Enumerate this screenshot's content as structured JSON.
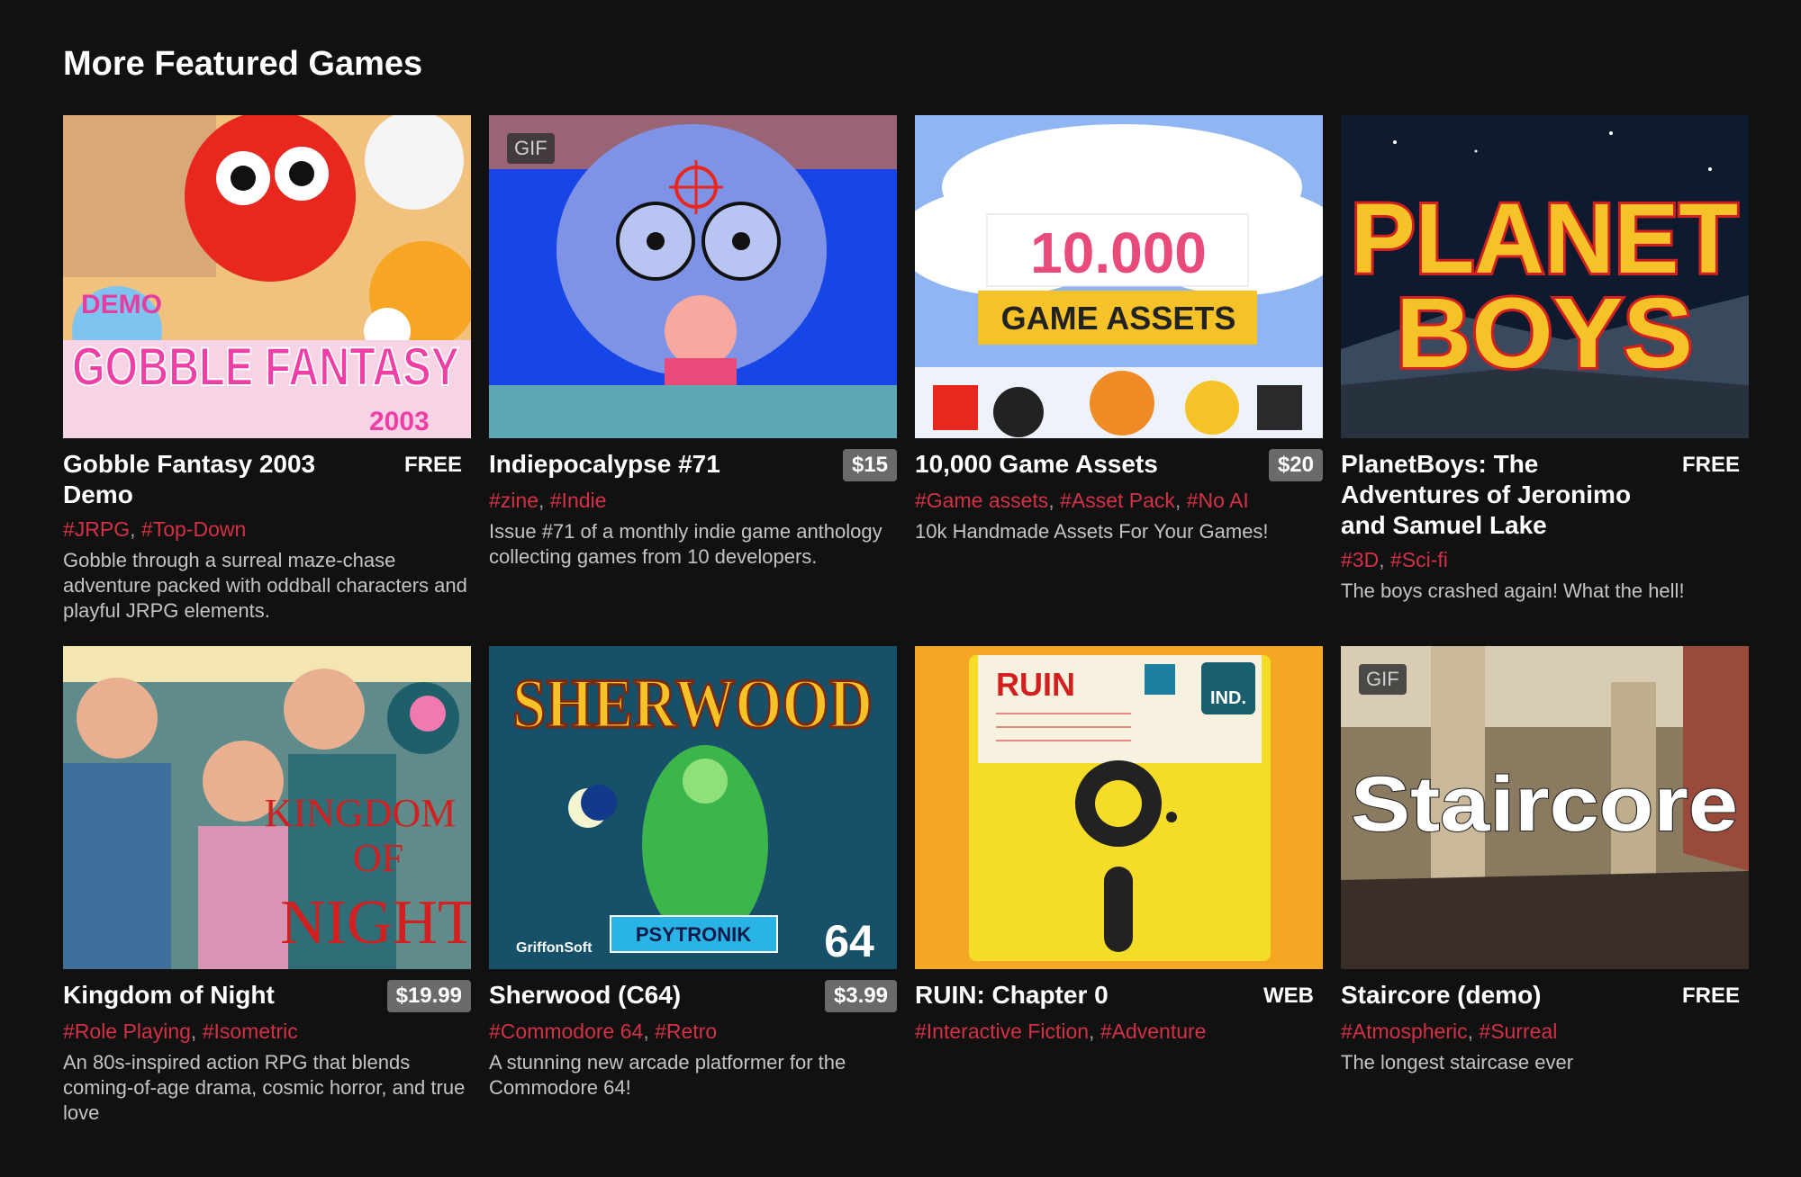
{
  "section": {
    "title": "More Featured Games"
  },
  "games": [
    {
      "title": "Gobble Fantasy 2003 Demo",
      "price": "FREE",
      "price_boxed": false,
      "tags": [
        "#JRPG",
        "#Top-Down"
      ],
      "description": "Gobble through a surreal maze-chase adventure packed with oddball characters and playful JRPG elements.",
      "art": {
        "line1": "DEMO",
        "line2": "GOBBLE FANTASY",
        "line3": "2003"
      }
    },
    {
      "title": "Indiepocalypse #71",
      "price": "$15",
      "price_boxed": true,
      "gif": "GIF",
      "tags": [
        "#zine",
        "#Indie"
      ],
      "description": "Issue #71 of a monthly indie game anthology collecting games from 10 developers."
    },
    {
      "title": "10,000 Game Assets",
      "price": "$20",
      "price_boxed": true,
      "tags": [
        "#Game assets",
        "#Asset Pack",
        "#No AI"
      ],
      "description": "10k Handmade Assets For Your Games!",
      "art": {
        "line1": "10.000",
        "line2": "GAME ASSETS"
      }
    },
    {
      "title": "PlanetBoys: The Adventures of Jeronimo and Samuel Lake",
      "price": "FREE",
      "price_boxed": false,
      "tags": [
        "#3D",
        "#Sci-fi"
      ],
      "description": "The boys crashed again! What the hell!",
      "art": {
        "line1": "PLANET",
        "line2": "BOYS"
      }
    },
    {
      "title": "Kingdom of Night",
      "price": "$19.99",
      "price_boxed": true,
      "tags": [
        "#Role Playing",
        "#Isometric"
      ],
      "description": "An 80s-inspired action RPG that blends coming-of-age drama, cosmic horror, and true love",
      "art": {
        "line1": "KINGDOM",
        "line2": "OF",
        "line3": "NIGHT"
      }
    },
    {
      "title": "Sherwood (C64)",
      "price": "$3.99",
      "price_boxed": true,
      "tags": [
        "#Commodore 64",
        "#Retro"
      ],
      "description": "A stunning new arcade platformer for the Commodore 64!",
      "art": {
        "line1": "SHERWOOD",
        "line2": "GriffonSoft",
        "line3": "PSYTRONIK",
        "line4": "64"
      }
    },
    {
      "title": "RUIN: Chapter 0",
      "price": "WEB",
      "price_boxed": false,
      "tags": [
        "#Interactive Fiction",
        "#Adventure"
      ],
      "description": "",
      "art": {
        "line1": "RUIN",
        "line2": "IND."
      }
    },
    {
      "title": "Staircore (demo)",
      "price": "FREE",
      "price_boxed": false,
      "gif": "GIF",
      "tags": [
        "#Atmospheric",
        "#Surreal"
      ],
      "description": "The longest staircase ever",
      "art": {
        "line1": "Staircore"
      }
    }
  ]
}
